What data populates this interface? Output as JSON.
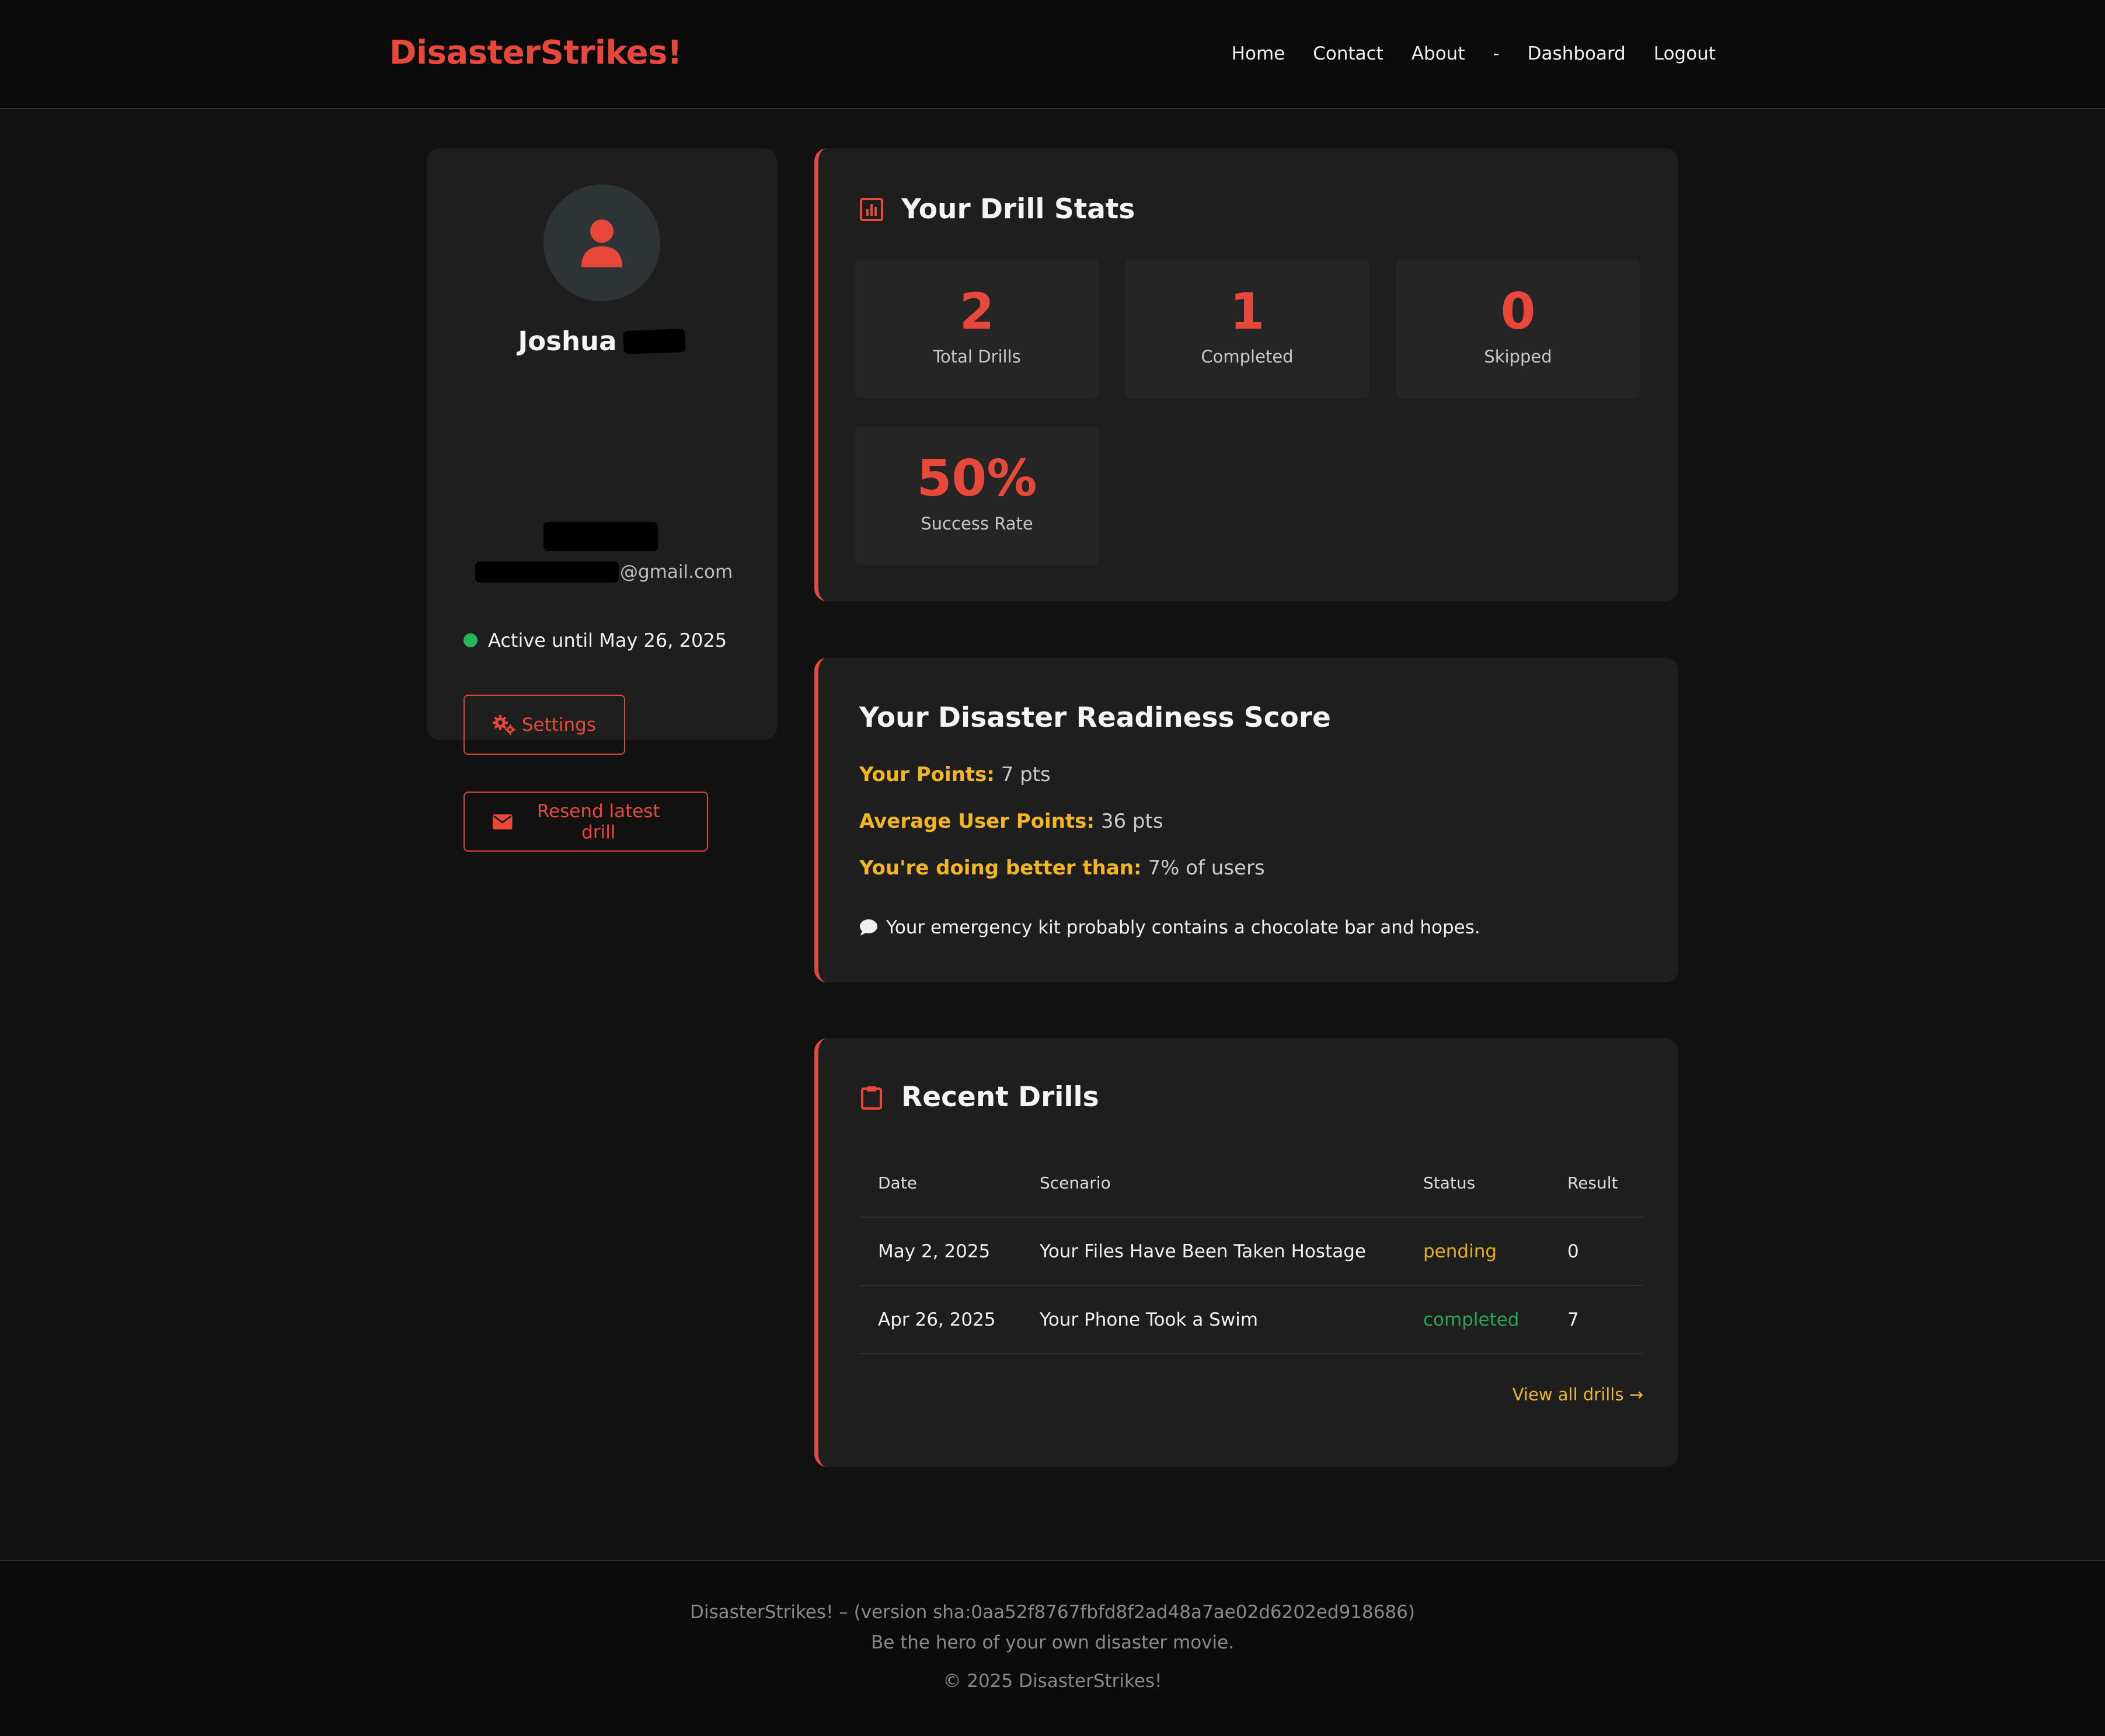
{
  "nav": {
    "brand": "DisasterStrikes!",
    "links": [
      "Home",
      "Contact",
      "About",
      "-",
      "Dashboard",
      "Logout"
    ]
  },
  "profile": {
    "first_name": "Joshua",
    "email_suffix": "@gmail.com",
    "status": "Active until May 26, 2025",
    "settings_label": "Settings",
    "resend_label": "Resend latest drill",
    "colors": {
      "accent": "#e8483a",
      "status_dot": "#22b55e"
    }
  },
  "stats": {
    "title": "Your Drill Stats",
    "items": [
      {
        "value": "2",
        "label": "Total Drills"
      },
      {
        "value": "1",
        "label": "Completed"
      },
      {
        "value": "0",
        "label": "Skipped"
      },
      {
        "value": "50%",
        "label": "Success Rate"
      }
    ]
  },
  "readiness": {
    "title": "Your Disaster Readiness Score",
    "points_key": "Your Points:",
    "points_val": "7 pts",
    "avg_key": "Average User Points:",
    "avg_val": "36 pts",
    "better_key": "You're doing better than:",
    "better_val": "7% of users",
    "quip": "Your emergency kit probably contains a chocolate bar and hopes."
  },
  "drills": {
    "title": "Recent Drills",
    "headers": [
      "Date",
      "Scenario",
      "Status",
      "Result"
    ],
    "rows": [
      {
        "date": "May 2, 2025",
        "scenario": "Your Files Have Been Taken Hostage",
        "status": "pending",
        "result": "0"
      },
      {
        "date": "Apr 26, 2025",
        "scenario": "Your Phone Took a Swim",
        "status": "completed",
        "result": "7"
      }
    ],
    "view_all": "View all drills →"
  },
  "footer": {
    "version": "DisasterStrikes! – (version sha:0aa52f8767fbfd8f2ad48a7ae02d6202ed918686)",
    "tagline": "Be the hero of your own disaster movie.",
    "copyright": "© 2025 DisasterStrikes!"
  }
}
